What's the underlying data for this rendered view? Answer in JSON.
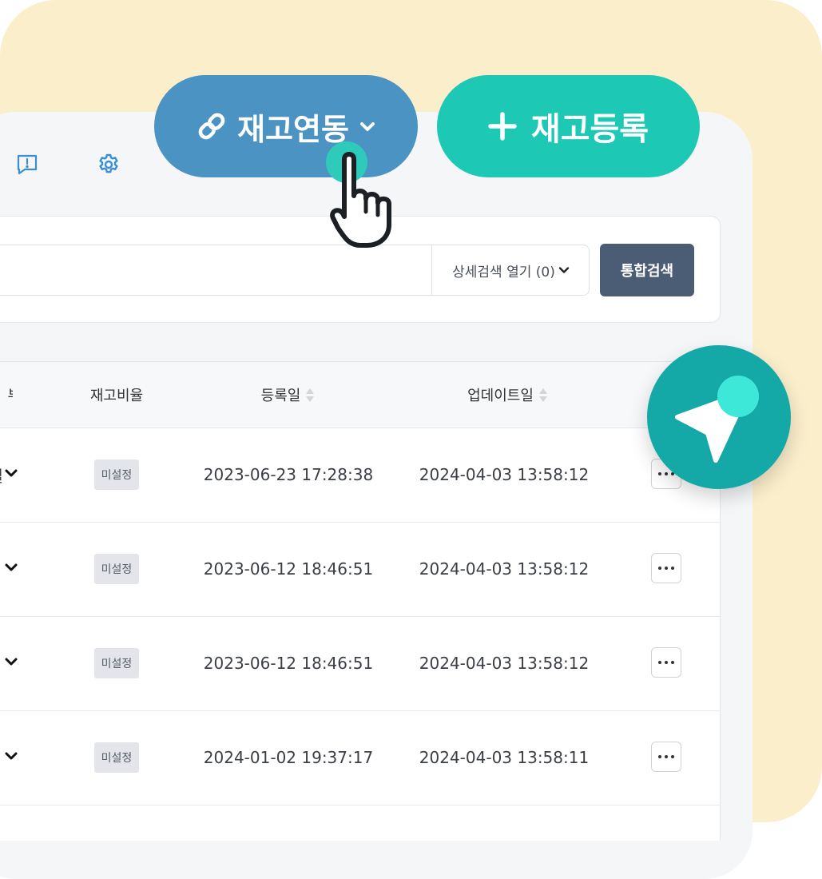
{
  "toolbar": {
    "stock_link": {
      "label": "재고연동",
      "icon": "link-icon"
    },
    "stock_register": {
      "label": "재고등록",
      "icon": "plus-icon"
    },
    "icons": [
      "feedback-icon",
      "gear-icon"
    ]
  },
  "search": {
    "advanced_toggle": "상세검색 열기 (0)",
    "button_label": "통합검색"
  },
  "table": {
    "columns": {
      "partial": "부",
      "ratio": "재고비율",
      "registered": "등록일",
      "updated": "업데이트일"
    },
    "rows": [
      {
        "partial_text": "일",
        "ratio": "미설정",
        "registered": "2023-06-23 17:28:38",
        "updated": "2024-04-03 13:58:12"
      },
      {
        "partial_text": "",
        "ratio": "미설정",
        "registered": "2023-06-12 18:46:51",
        "updated": "2024-04-03 13:58:12"
      },
      {
        "partial_text": "",
        "ratio": "미설정",
        "registered": "2023-06-12 18:46:51",
        "updated": "2024-04-03 13:58:12"
      },
      {
        "partial_text": "",
        "ratio": "미설정",
        "registered": "2024-01-02 19:37:17",
        "updated": "2024-04-03 13:58:11"
      }
    ]
  },
  "colors": {
    "background": "#fbeecb",
    "link_button": "#4a93c3",
    "register_button": "#1dc8b5",
    "search_button": "#4a5d75",
    "fab": "#14a9a7",
    "highlight": "#3de8d9"
  }
}
